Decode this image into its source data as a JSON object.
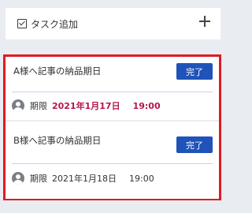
{
  "add_task": {
    "label": "タスク追加",
    "left_icon": "checkbox-icon",
    "right_icon": "plus-icon"
  },
  "tasks": [
    {
      "title": "A様へ記事の納品期日",
      "done_label": "完了",
      "deadline_label": "期限",
      "date": "2021年1月17日",
      "time": "19:00",
      "overdue": true
    },
    {
      "title": "B様へ記事の納品期日",
      "done_label": "完了",
      "deadline_label": "期限",
      "date": "2021年1月18日",
      "time": "19:00",
      "overdue": false
    }
  ],
  "colors": {
    "done_button": "#1f53b9",
    "overdue_text": "#b4164f",
    "highlight_border": "#e01a22",
    "background": "#e9ecf1"
  }
}
